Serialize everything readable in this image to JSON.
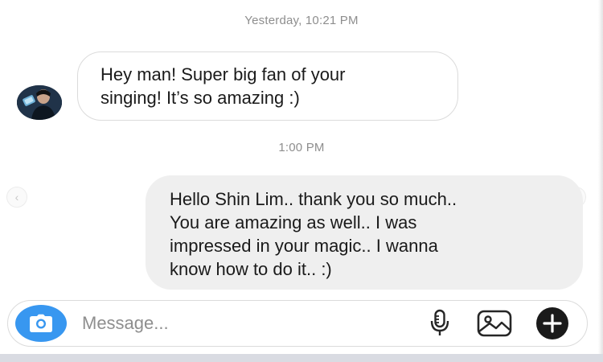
{
  "timestamps": {
    "first": "Yesterday, 10:21 PM",
    "second": "1:00 PM"
  },
  "messages": {
    "incoming": {
      "lines": [
        "Hey man! Super big fan of your",
        "singing! It’s so amazing :)"
      ]
    },
    "outgoing": {
      "lines": [
        "Hello Shin Lim.. thank you so much..",
        "You are amazing as well.. I was",
        "impressed in your magic.. I wanna",
        "know how to do it.. :)"
      ]
    }
  },
  "composer": {
    "placeholder": "Message...",
    "icons": [
      "camera-icon",
      "microphone-icon",
      "gallery-icon",
      "plus-icon"
    ]
  },
  "navigation": {
    "left_arrow": "‹",
    "right_arrow": "›"
  },
  "colors": {
    "accent": "#3897f0",
    "outgoing_bubble": "#efefef",
    "incoming_border": "#dbdbdb",
    "timestamp_text": "#8e8e8e"
  }
}
